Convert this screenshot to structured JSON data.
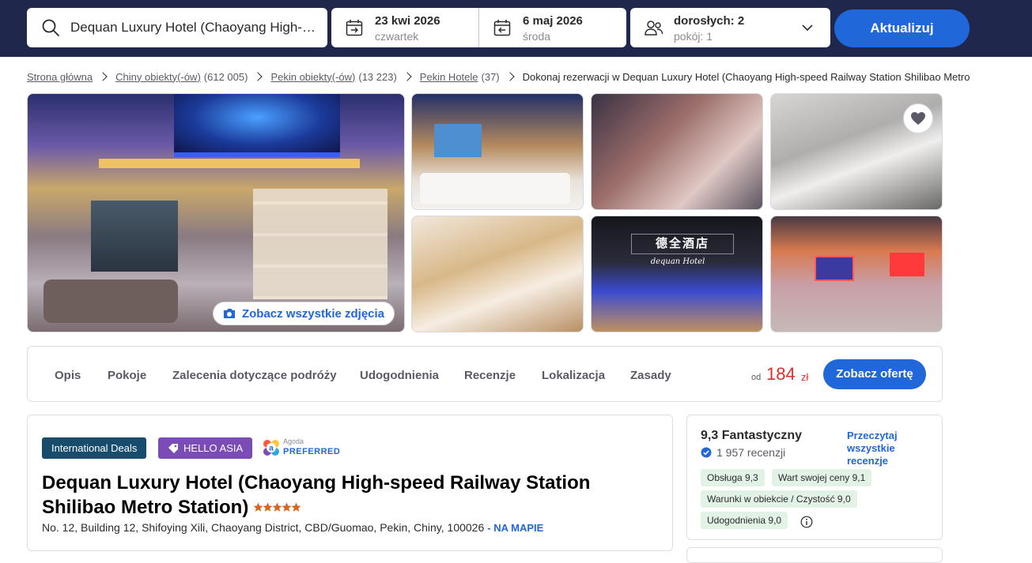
{
  "search": {
    "destination": "Dequan Luxury Hotel (Chaoyang High-speed Railway Station Shilibao Metro Station)",
    "checkin_date": "23 kwi 2026",
    "checkin_day": "czwartek",
    "checkout_date": "6 maj 2026",
    "checkout_day": "środa",
    "guests_main": "dorosłych: 2",
    "guests_sub": "pokój: 1",
    "update_label": "Aktualizuj"
  },
  "breadcrumbs": [
    {
      "label": "Strona główna",
      "count": ""
    },
    {
      "label": "Chiny obiekty(-ów)",
      "count": "(612 005)"
    },
    {
      "label": "Pekin obiekty(-ów)",
      "count": "(13 223)"
    },
    {
      "label": "Pekin Hotele",
      "count": "(37)"
    }
  ],
  "breadcrumb_current": "Dokonaj rezerwacji w Dequan Luxury Hotel (Chaoyang High-speed Railway Station Shilibao Metro",
  "gallery": {
    "see_all_label": "Zobacz wszystkie zdjęcia",
    "hotel_sign": "德全酒店",
    "hotel_sign_sub": "dequan Hotel"
  },
  "tabs": [
    "Opis",
    "Pokoje",
    "Zalecenia dotyczące podróży",
    "Udogodnienia",
    "Recenzje",
    "Lokalizacja",
    "Zasady"
  ],
  "price": {
    "from": "od",
    "value": "184",
    "currency": "zł",
    "cta": "Zobacz ofertę"
  },
  "hotel": {
    "badges": {
      "international": "International Deals",
      "promo": "HELLO ASIA",
      "agoda_small": "Agoda",
      "agoda_preferred": "PREFERRED"
    },
    "name": "Dequan Luxury Hotel (Chaoyang High-speed Railway Station Shilibao Metro Station)",
    "stars": 5,
    "address": "No. 12, Building 12, Shifoying Xili, Chaoyang District, CBD/Guomao, Pekin, Chiny, 100026",
    "map_link": "- NA MAPIE"
  },
  "review": {
    "score_text": "9,3 Fantastyczny",
    "count_text": "1 957 recenzji",
    "read_all": "Przeczytaj wszystkie recenzje",
    "chips": [
      "Obsługa 9,3",
      "Wart swojej ceny 9,1",
      "Warunki w obiekcie / Czystość 9,0",
      "Udogodnienia 9,0"
    ]
  },
  "colors": {
    "brand_navy": "#20274d",
    "accent_blue": "#2067da",
    "price_red": "#e12d2d",
    "star": "#d9661f"
  },
  "icons": [
    "search-icon",
    "calendar-icon",
    "guests-icon",
    "chevron-down-icon",
    "camera-icon",
    "heart-icon",
    "tag-icon",
    "star-icon",
    "verified-icon",
    "info-icon"
  ]
}
